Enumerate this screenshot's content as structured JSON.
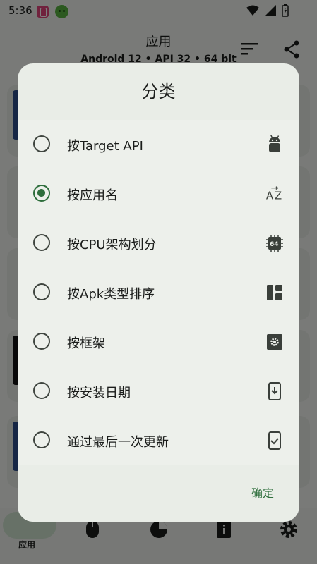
{
  "status_bar": {
    "time": "5:36"
  },
  "app_bar": {
    "title": "应用",
    "subtitle": "Android 12 • API 32 • 64 bit"
  },
  "bottom_nav": {
    "active_label": "应用"
  },
  "dialog": {
    "title": "分类",
    "options": [
      {
        "label": "按Target API",
        "icon": "android-icon",
        "checked": false
      },
      {
        "label": "按应用名",
        "icon": "sort-alpha-icon",
        "checked": true
      },
      {
        "label": "按CPU架构划分",
        "icon": "cpu-64-icon",
        "checked": false
      },
      {
        "label": "按Apk类型排序",
        "icon": "dashboard-icon",
        "checked": false
      },
      {
        "label": "按框架",
        "icon": "settings-box-icon",
        "checked": false
      },
      {
        "label": "按安装日期",
        "icon": "phone-download-icon",
        "checked": false
      },
      {
        "label": "通过最后一次更新",
        "icon": "phone-check-icon",
        "checked": false
      }
    ],
    "confirm_label": "确定"
  },
  "colors": {
    "accent": "#2e6e3c",
    "dialog_bg": "#e9ede7",
    "scrim": "#000000"
  }
}
